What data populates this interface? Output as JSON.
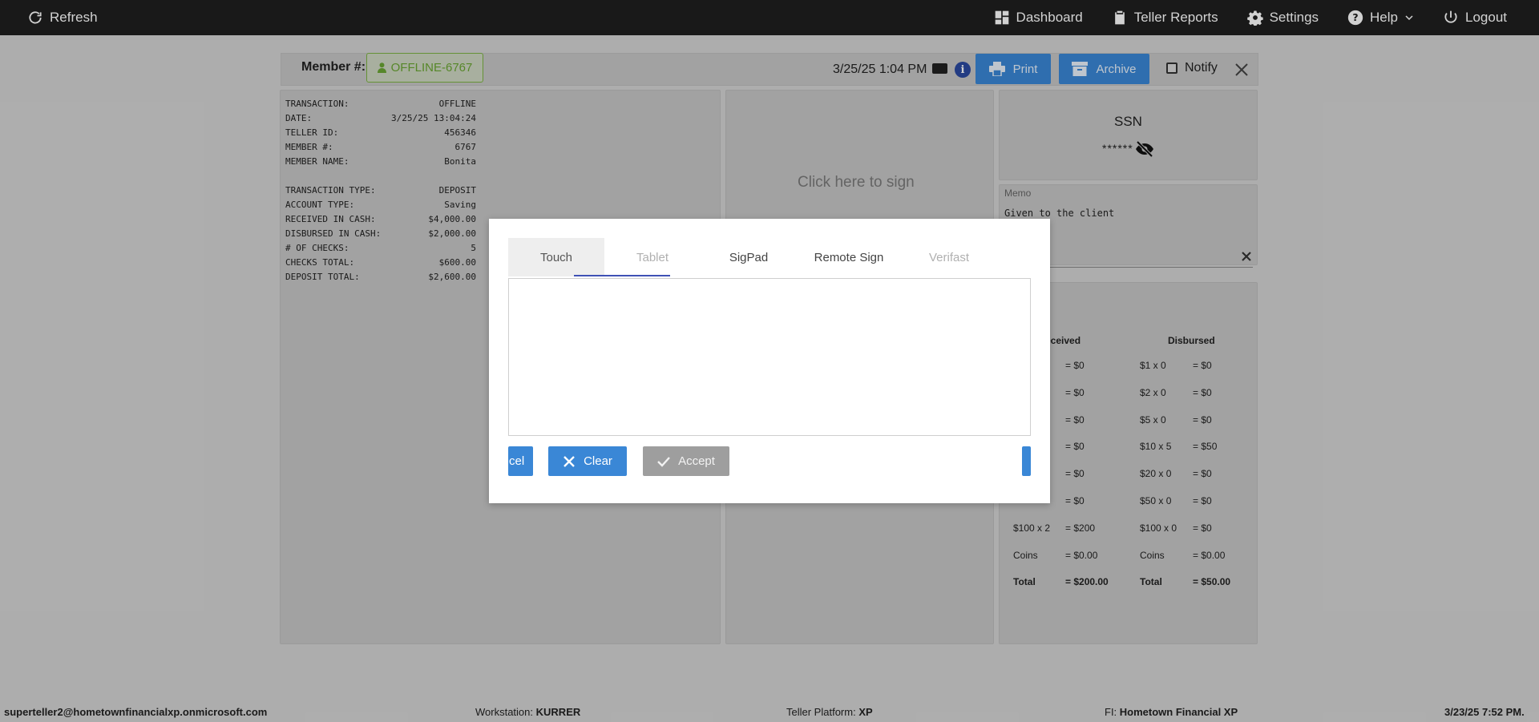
{
  "nav": {
    "refresh": "Refresh",
    "dashboard": "Dashboard",
    "teller_reports": "Teller Reports",
    "settings": "Settings",
    "help": "Help",
    "logout": "Logout"
  },
  "header": {
    "member_label": "Member #:",
    "member_value": "OFFLINE-6767",
    "datetime": "3/25/25 1:04 PM",
    "info": "i",
    "print": "Print",
    "archive": "Archive",
    "notify": "Notify"
  },
  "receipt": {
    "lines": [
      [
        "TRANSACTION:",
        "OFFLINE"
      ],
      [
        "DATE:",
        "3/25/25 13:04:24"
      ],
      [
        "TELLER ID:",
        "456346"
      ],
      [
        "MEMBER #:",
        "6767"
      ],
      [
        "MEMBER NAME:",
        "Bonita"
      ],
      [
        "",
        ""
      ],
      [
        "TRANSACTION TYPE:",
        "DEPOSIT"
      ],
      [
        "ACCOUNT TYPE:",
        "Saving"
      ],
      [
        "RECEIVED IN CASH:",
        "$4,000.00"
      ],
      [
        "DISBURSED IN CASH:",
        "$2,000.00"
      ],
      [
        "# OF CHECKS:",
        "5"
      ],
      [
        "CHECKS TOTAL:",
        "$600.00"
      ],
      [
        "DEPOSIT TOTAL:",
        "$2,600.00"
      ]
    ]
  },
  "sign_panel": {
    "prompt": "Click here to sign"
  },
  "ssn": {
    "title": "SSN",
    "masked": "******"
  },
  "memo": {
    "label": "Memo",
    "text": "Given to the client"
  },
  "cash": {
    "received_header": "eceived",
    "disbursed_header": "Disbursed",
    "received_rows": [
      [
        "",
        "= $0"
      ],
      [
        "",
        "= $0"
      ],
      [
        "",
        "= $0"
      ],
      [
        "",
        "= $0"
      ],
      [
        "",
        "= $0"
      ],
      [
        "",
        "= $0"
      ],
      [
        "$100 x 2",
        "= $200"
      ],
      [
        "Coins",
        "= $0.00"
      ],
      [
        "Total",
        "= $200.00"
      ]
    ],
    "disbursed_rows": [
      [
        "$1 x 0",
        "= $0"
      ],
      [
        "$2 x 0",
        "= $0"
      ],
      [
        "$5 x 0",
        "= $0"
      ],
      [
        "$10 x 5",
        "= $50"
      ],
      [
        "$20 x 0",
        "= $0"
      ],
      [
        "$50 x 0",
        "= $0"
      ],
      [
        "$100 x 0",
        "= $0"
      ],
      [
        "Coins",
        "= $0.00"
      ],
      [
        "Total",
        "= $50.00"
      ]
    ]
  },
  "footer": {
    "user": "superteller2@hometownfinancialxp.onmicrosoft.com",
    "workstation_label": "Workstation:",
    "workstation": "KURRER",
    "platform_label": "Teller Platform:",
    "platform": "XP",
    "fi_label": "FI:",
    "fi": "Hometown Financial XP",
    "datetime": "3/23/25 7:52 PM."
  },
  "modal": {
    "tabs": [
      "Touch",
      "Tablet",
      "SigPad",
      "Remote Sign",
      "Verifast"
    ],
    "cancel": "cel",
    "clear": "Clear",
    "accept": "Accept"
  }
}
